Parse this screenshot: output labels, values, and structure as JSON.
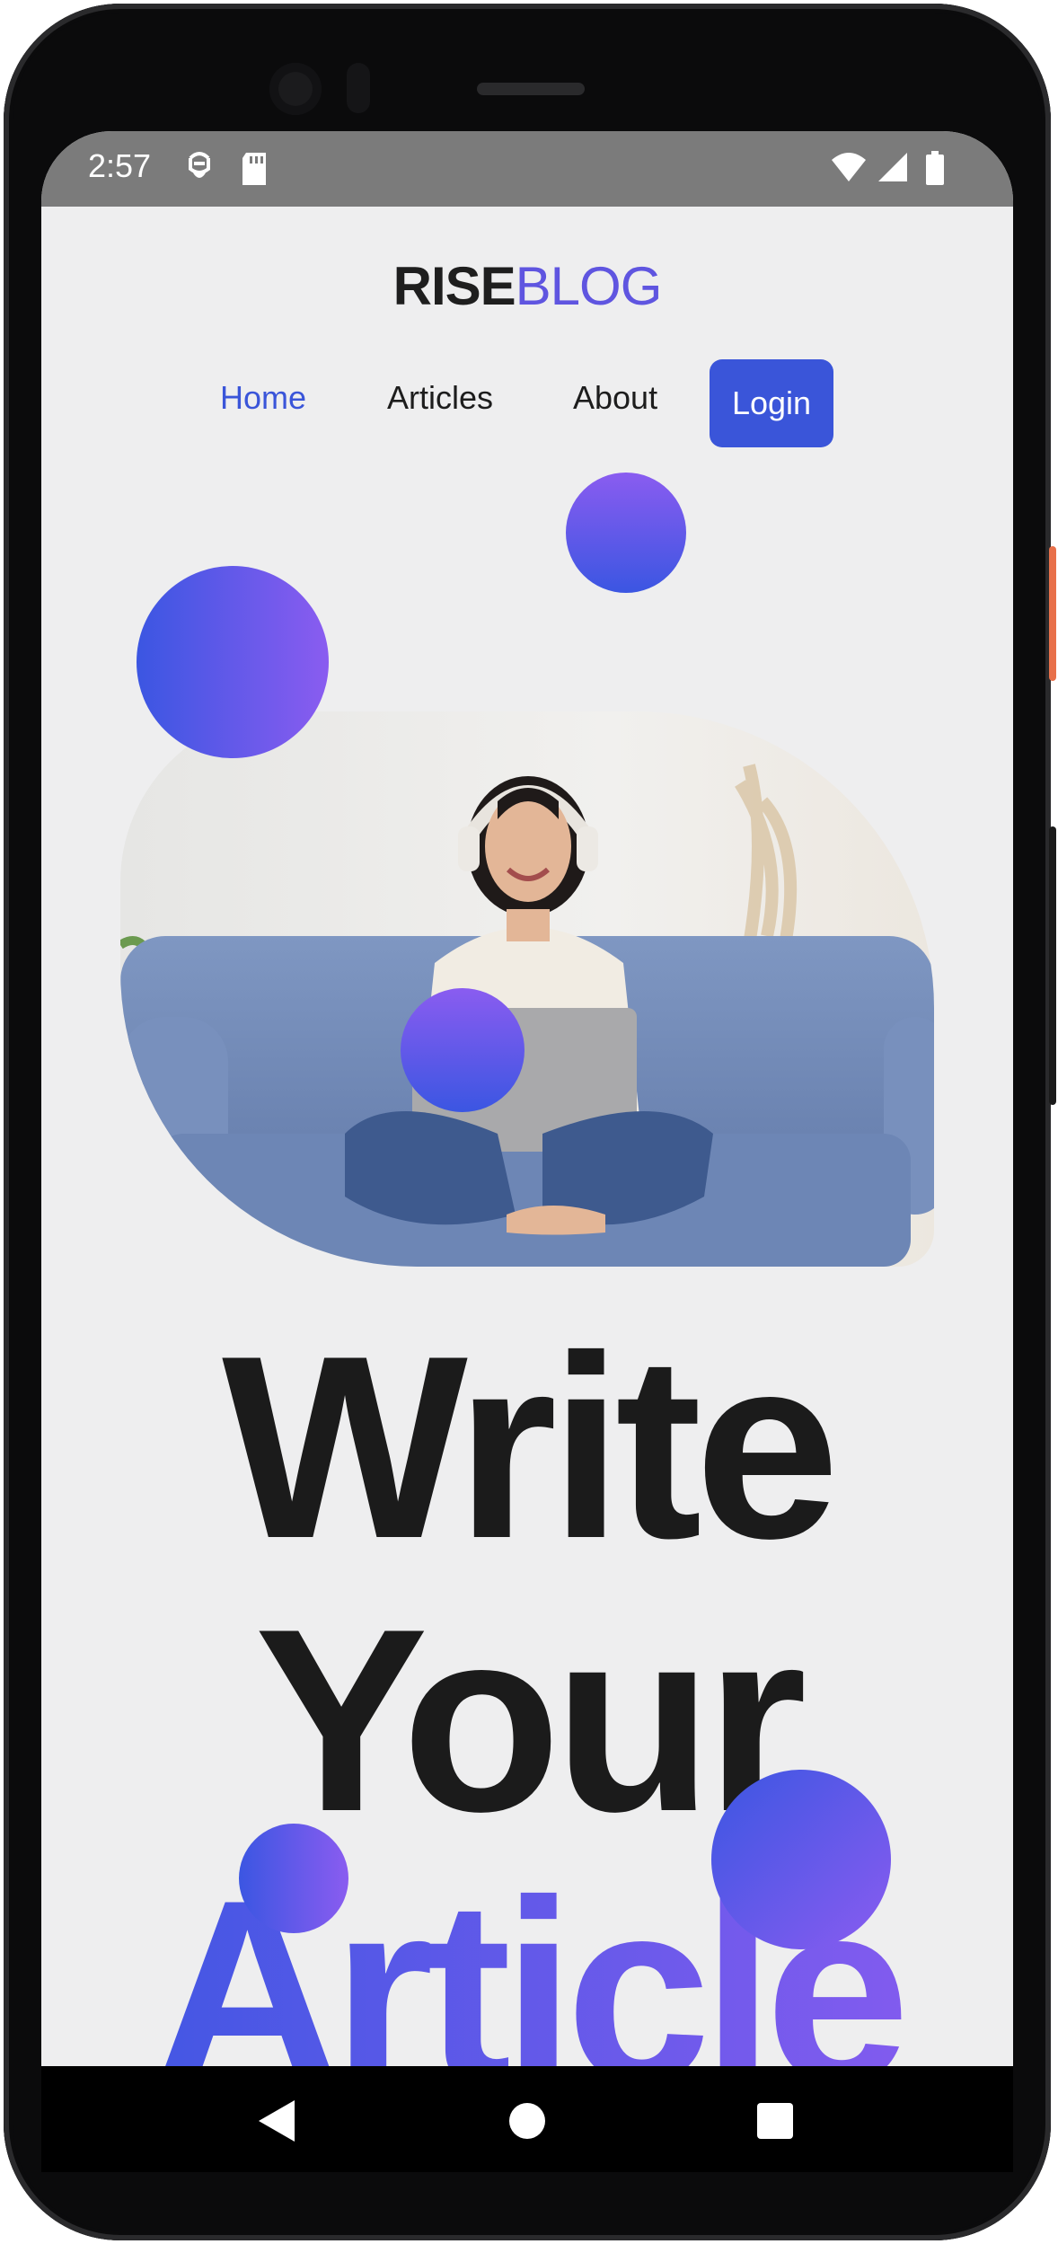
{
  "status_bar": {
    "time": "2:57",
    "icons": [
      "face-id-icon",
      "sd-card-icon",
      "wifi-icon",
      "signal-icon",
      "battery-icon"
    ]
  },
  "header": {
    "logo_part1": "RISE",
    "logo_part2": "BLOG"
  },
  "nav": {
    "items": [
      {
        "label": "Home",
        "active": true
      },
      {
        "label": "Articles",
        "active": false
      },
      {
        "label": "About",
        "active": false
      }
    ],
    "login_label": "Login"
  },
  "hero": {
    "line1": "Write",
    "line2": "Your",
    "line3": "Article",
    "image_alt": "woman-with-laptop-on-sofa"
  },
  "colors": {
    "accent": "#3a55d9",
    "gradient_start": "#3b56e2",
    "gradient_end": "#8a5cf0",
    "background": "#eeeeef",
    "text": "#1b1b1b"
  },
  "system_nav": {
    "icons": [
      "back-icon",
      "home-icon",
      "recents-icon"
    ]
  }
}
